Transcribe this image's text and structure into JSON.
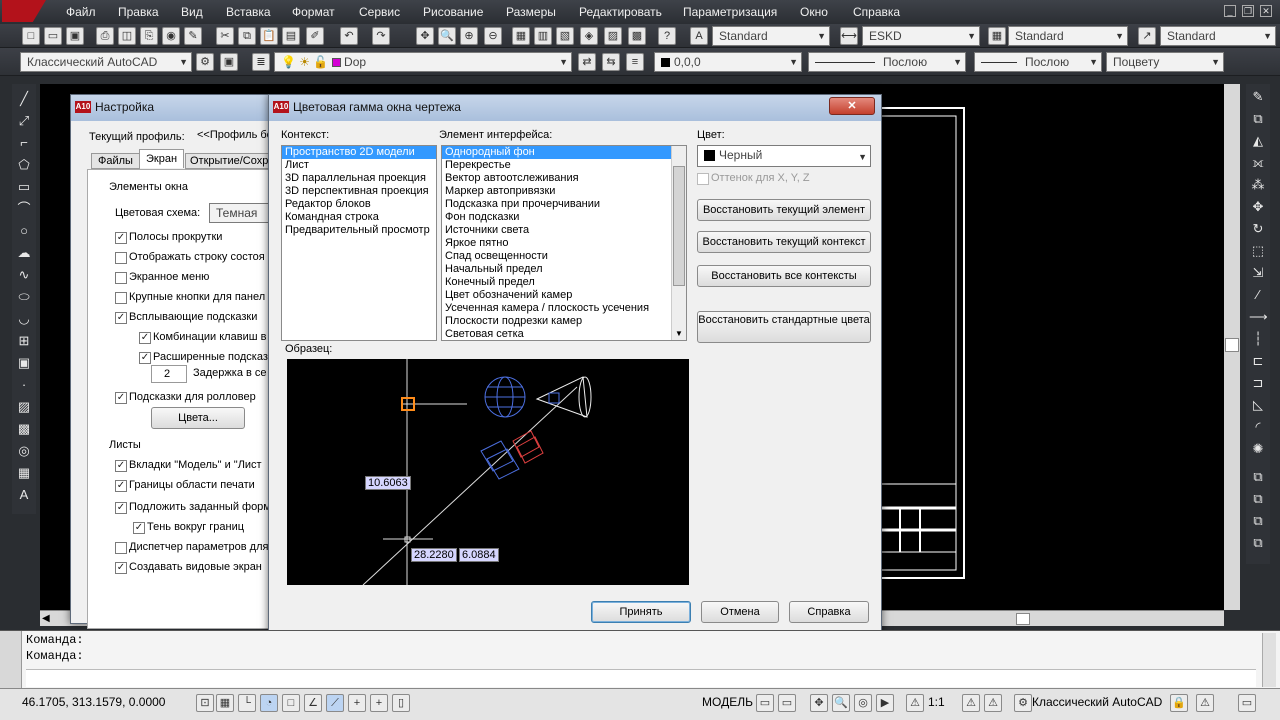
{
  "menubar": {
    "items": [
      "Файл",
      "Правка",
      "Вид",
      "Вставка",
      "Формат",
      "Сервис",
      "Рисование",
      "Размеры",
      "Редактировать",
      "Параметризация",
      "Окно",
      "Справка"
    ]
  },
  "toolbar1": {
    "text_style": "Standard",
    "dim_style": "ESKD",
    "table_style": "Standard",
    "multileader_style": "Standard"
  },
  "toolbar2": {
    "workspace": "Классический AutoCAD",
    "layer": "Dop",
    "color": "0,0,0",
    "linetype": "Послою",
    "lineweight": "Послою",
    "plotstyle": "Поцвету"
  },
  "command": {
    "line1": "Команда:",
    "line2": "Команда:"
  },
  "status": {
    "coords": "46.1705,  313.1579, 0.0000",
    "model": "МОДЕЛЬ",
    "scale": "1:1",
    "workspace": "Классический AutoCAD"
  },
  "options_dialog": {
    "title": "Настройка",
    "profile_label": "Текущий профиль:",
    "profile_value": "<<Профиль бе",
    "tabs": [
      "Файлы",
      "Экран",
      "Открытие/Сохр"
    ],
    "window_elements_heading": "Элементы окна",
    "color_scheme_label": "Цветовая схема:",
    "color_scheme_value": "Темная",
    "options": [
      {
        "label": "Полосы прокрутки",
        "checked": true
      },
      {
        "label": "Отображать строку состоя",
        "checked": false
      },
      {
        "label": "Экранное меню",
        "checked": false
      },
      {
        "label": "Крупные кнопки для панел",
        "checked": false
      },
      {
        "label": "Всплывающие подсказки",
        "checked": true
      }
    ],
    "sub_options": [
      {
        "label": "Комбинации клавиш в",
        "checked": true
      },
      {
        "label": "Расширенные подсказ",
        "checked": true
      }
    ],
    "delay_value": "2",
    "delay_label": "Задержка в се",
    "rollover_label": "Подсказки для ролловер",
    "colors_button": "Цвета...",
    "sheets_heading": "Листы",
    "sheet_options": [
      {
        "label": "Вкладки \"Модель\" и \"Лист",
        "checked": true
      },
      {
        "label": "Границы области печати",
        "checked": true
      },
      {
        "label": "Подложить заданный форм",
        "checked": true
      }
    ],
    "shadow_label": "Тень вокруг границ",
    "sheet_options2": [
      {
        "label": "Диспетчер параметров для",
        "checked": false
      },
      {
        "label": "Создавать видовые экран",
        "checked": true
      }
    ]
  },
  "color_dialog": {
    "title": "Цветовая гамма окна чертежа",
    "context_label": "Контекст:",
    "contexts": [
      "Пространство 2D модели",
      "Лист",
      "3D параллельная проекция",
      "3D перспективная проекция",
      "Редактор блоков",
      "Командная строка",
      "Предварительный просмотр"
    ],
    "element_label": "Элемент интерфейса:",
    "elements": [
      "Однородный фон",
      "Перекрестье",
      "Вектор автоотслеживания",
      "Маркер автопривязки",
      "Подсказка при прочерчивании",
      "Фон подсказки",
      "Источники света",
      "Яркое пятно",
      "Спад освещенности",
      "Начальный предел",
      "Конечный предел",
      "Цвет обозначений камер",
      "Усеченная камера / плоскость усечения",
      "Плоскости подрезки камер",
      "Световая сетка"
    ],
    "color_label": "Цвет:",
    "color_value": "Черный",
    "tint_label": "Оттенок для X, Y, Z",
    "restore_element": "Восстановить текущий элемент",
    "restore_context": "Восстановить текущий контекст",
    "restore_all": "Восстановить все контексты",
    "restore_classic": "Восстановить стандартные цвета",
    "preview_label": "Образец:",
    "preview_dims": [
      "10.6063",
      "28.2280",
      "6.0884"
    ],
    "ok": "Принять",
    "cancel": "Отмена",
    "help": "Справка",
    "close": "✕"
  }
}
